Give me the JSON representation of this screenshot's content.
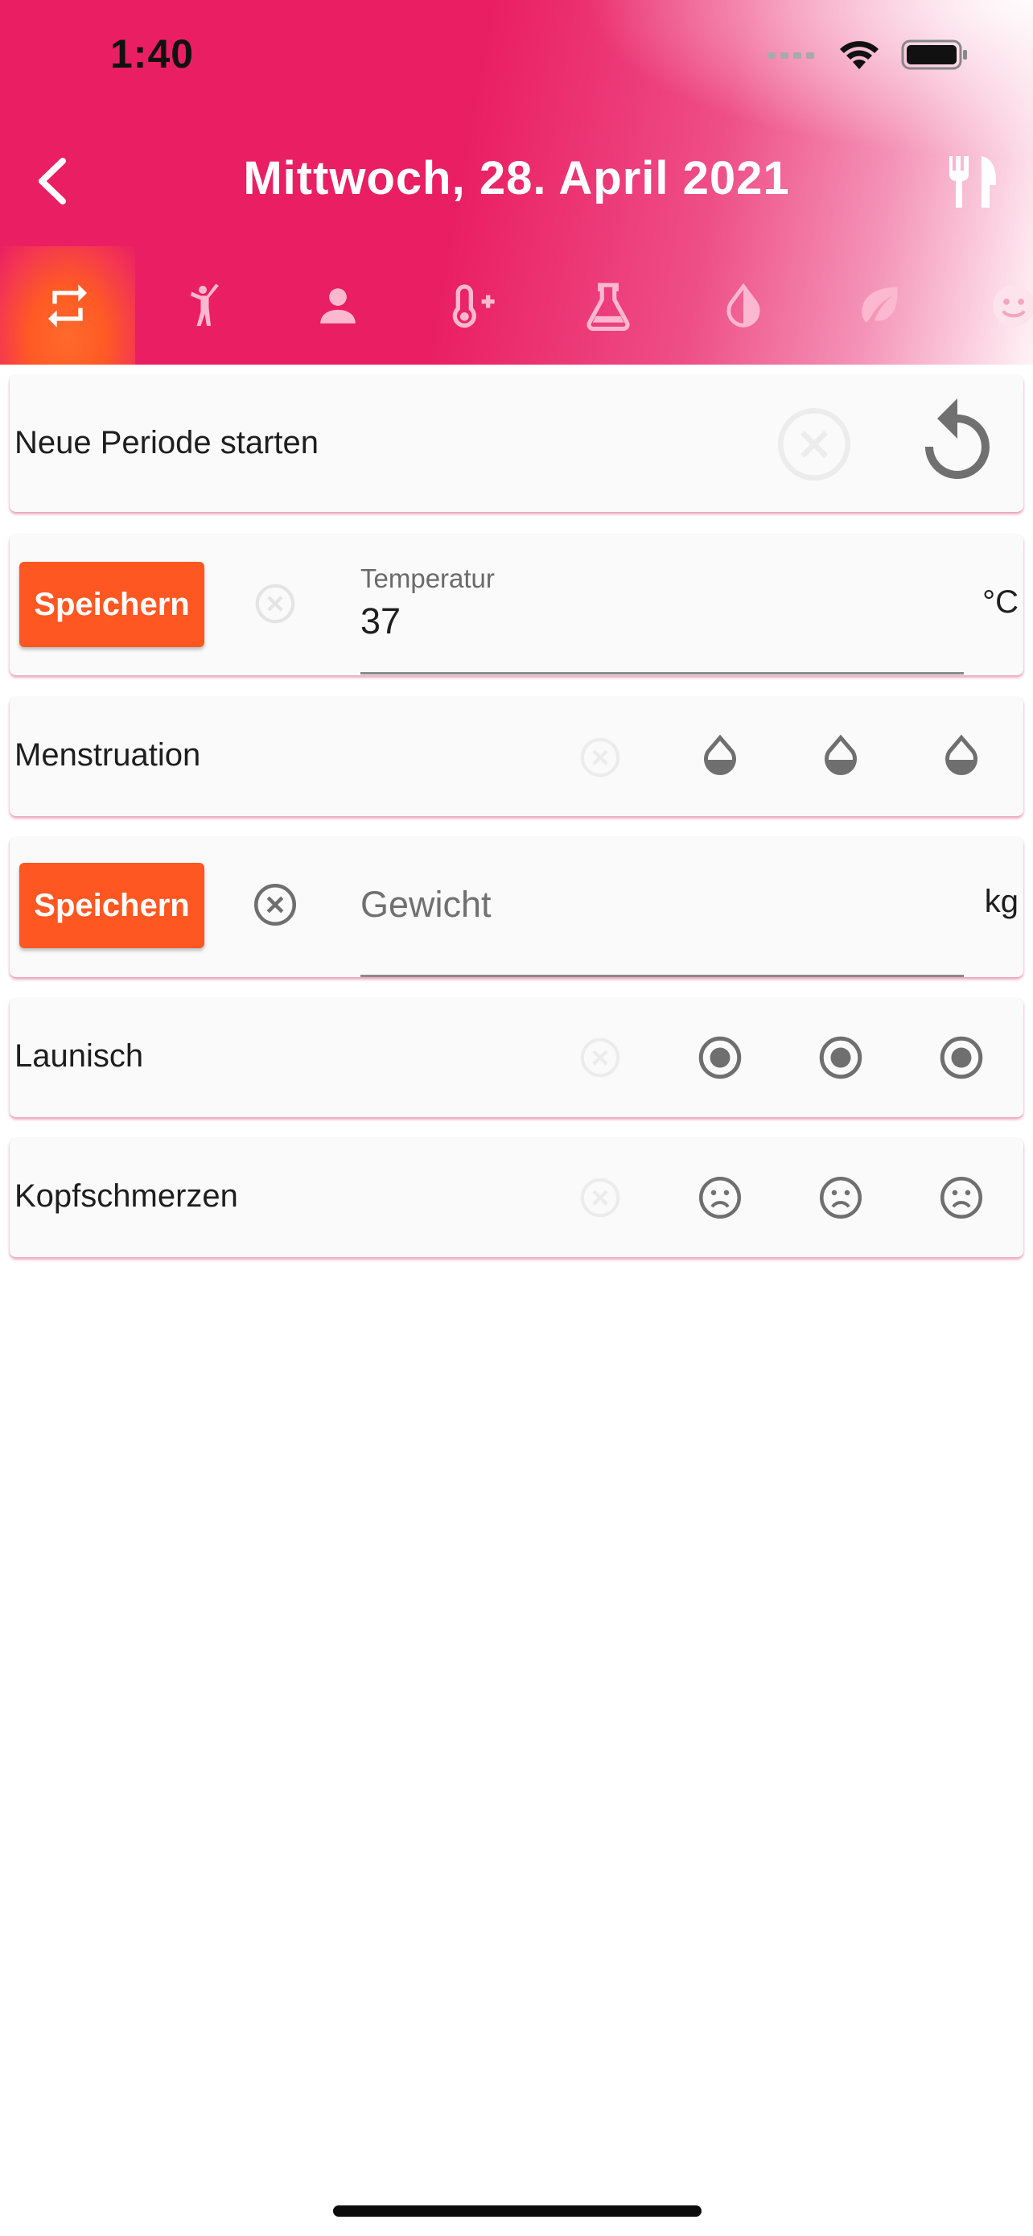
{
  "status_bar": {
    "time": "1:40"
  },
  "header": {
    "title": "Mittwoch, 28. April 2021",
    "tabs": [
      {
        "icon": "swap-icon",
        "active": true
      },
      {
        "icon": "person-exercise-icon",
        "active": false
      },
      {
        "icon": "person-icon",
        "active": false
      },
      {
        "icon": "thermometer-plus-icon",
        "active": false
      },
      {
        "icon": "flask-icon",
        "active": false
      },
      {
        "icon": "half-drop-icon",
        "active": false
      },
      {
        "icon": "leaf-icon",
        "active": false
      },
      {
        "icon": "smiley-icon",
        "active": false
      }
    ]
  },
  "cards": {
    "period": {
      "label": "Neue Periode starten"
    },
    "temperature": {
      "save_label": "Speichern",
      "field_label": "Temperatur",
      "value": "37",
      "unit": "°C"
    },
    "menstruation": {
      "label": "Menstruation"
    },
    "weight": {
      "save_label": "Speichern",
      "placeholder": "Gewicht",
      "unit": "kg"
    },
    "mood": {
      "label": "Launisch"
    },
    "headache": {
      "label": "Kopfschmerzen"
    }
  },
  "colors": {
    "accent": "#ff5722",
    "primary": "#ea1f63",
    "icon_gray": "#757575"
  }
}
